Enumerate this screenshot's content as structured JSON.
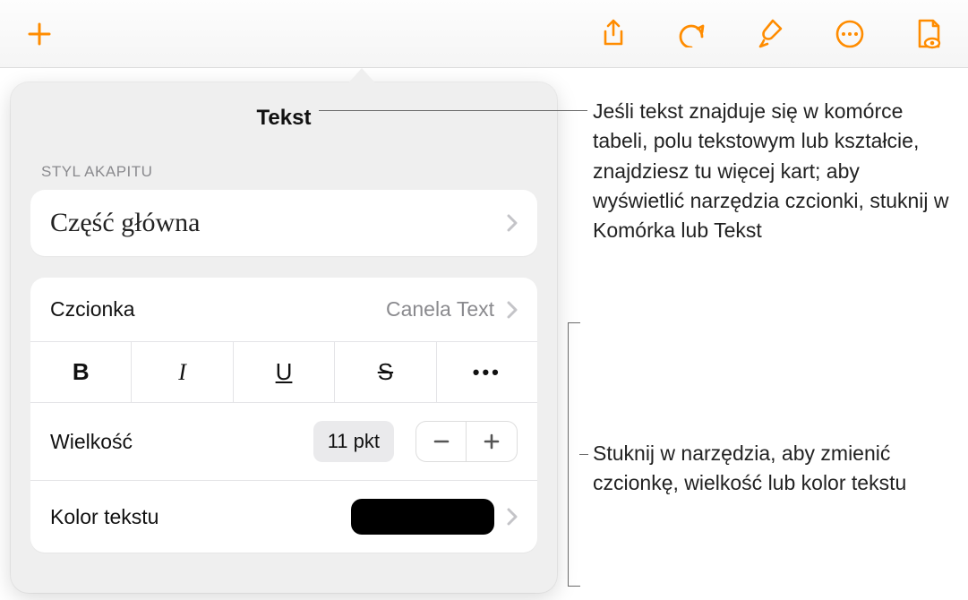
{
  "toolbar": {
    "icons": [
      "plus",
      "share",
      "undo",
      "format",
      "more",
      "document"
    ]
  },
  "panel": {
    "title": "Tekst",
    "paragraph_section_label": "STYL AKAPITU",
    "paragraph_style": "Część główna",
    "font_label": "Czcionka",
    "font_value": "Canela Text",
    "bius": {
      "bold": "B",
      "italic": "I",
      "underline": "U",
      "strike": "S"
    },
    "size_label": "Wielkość",
    "size_value": "11 pkt",
    "color_label": "Kolor tekstu",
    "color_value": "#000000"
  },
  "callouts": {
    "top": "Jeśli tekst znajduje się w komórce tabeli, polu tekstowym lub kształcie, znajdziesz tu więcej kart; aby wyświetlić narzędzia czcionki, stuknij w Komórka lub Tekst",
    "bottom": "Stuknij w narzędzia, aby zmienić czcionkę, wielkość lub kolor tekstu"
  }
}
